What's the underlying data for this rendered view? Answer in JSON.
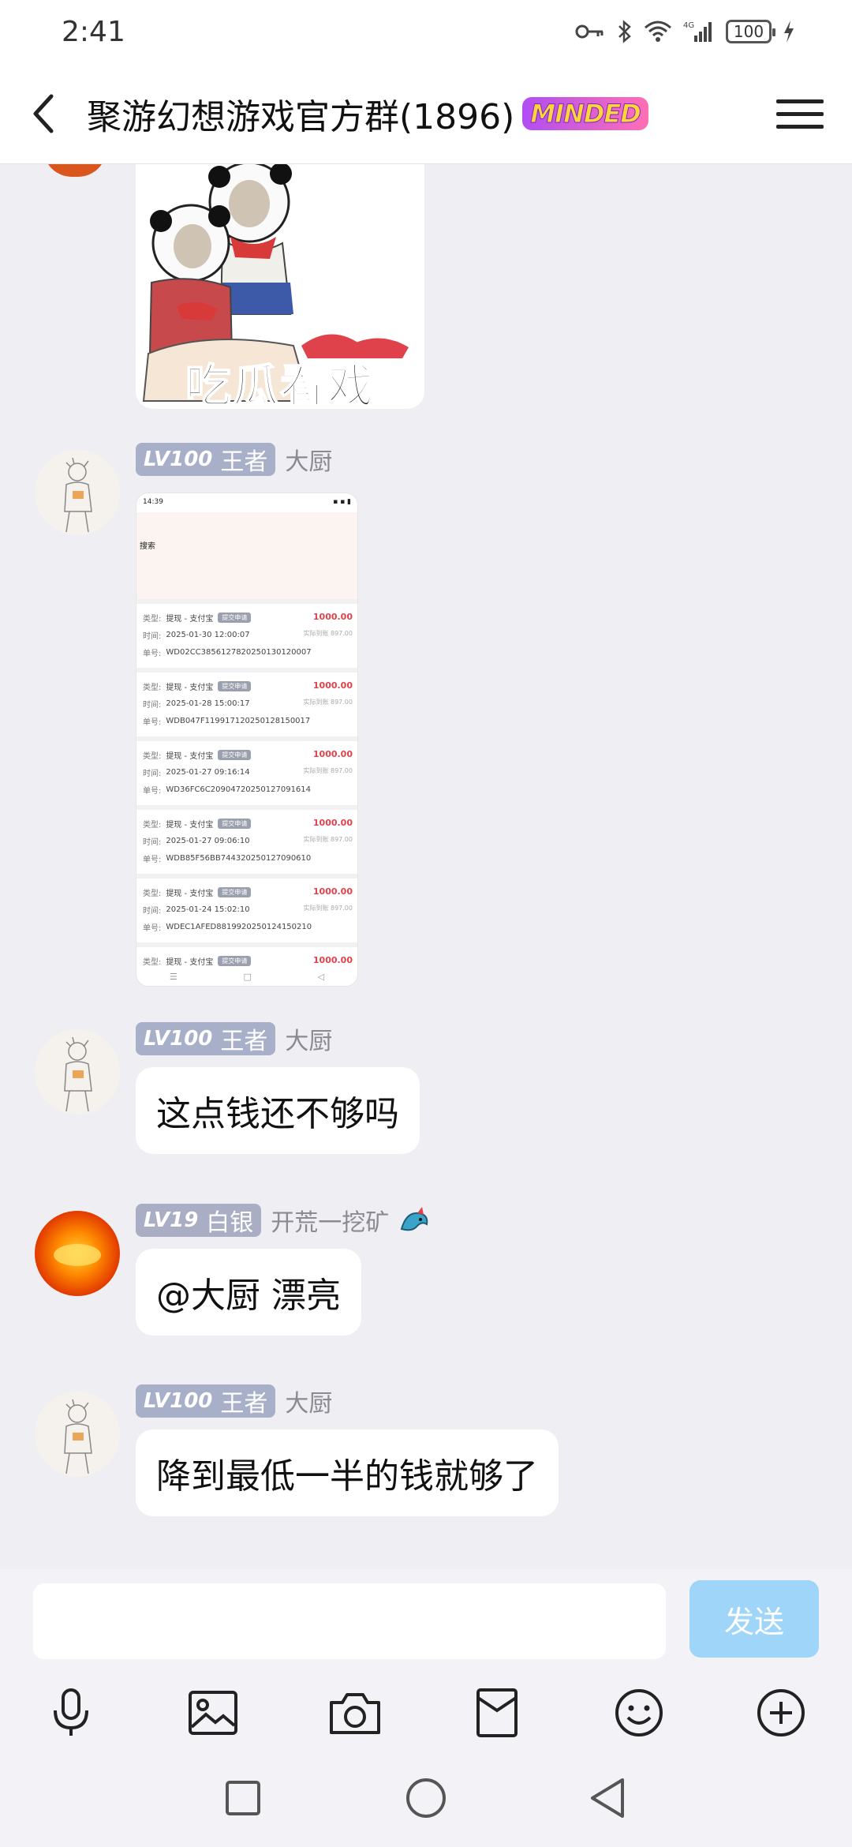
{
  "status": {
    "time": "2:41",
    "battery": "100",
    "network": "4G"
  },
  "header": {
    "title": "聚游幻想游戏官方群(1896)",
    "badge": "MINDED"
  },
  "sticker": {
    "caption": "吃瓜看戏"
  },
  "messages": [
    {
      "level": "LV100",
      "rank": "王者",
      "name": "大厨"
    },
    {
      "level": "LV100",
      "rank": "王者",
      "name": "大厨",
      "text": "这点钱还不够吗"
    },
    {
      "level": "LV19",
      "rank": "白银",
      "name": "开荒一挖矿",
      "text": "@大厨 漂亮"
    },
    {
      "level": "LV100",
      "rank": "王者",
      "name": "大厨",
      "text": "降到最低一半的钱就够了"
    }
  ],
  "screenshot": {
    "time": "14:39",
    "search": "搜索",
    "rows": [
      {
        "type": "提现 - 支付宝",
        "tag": "提交申请",
        "amount": "1000.00",
        "real": "实际到账 897.00",
        "time": "2025-01-30 12:00:07",
        "order": "WD02CC3856127820250130120007"
      },
      {
        "type": "提现 - 支付宝",
        "tag": "提交申请",
        "amount": "1000.00",
        "real": "实际到账 897.00",
        "time": "2025-01-28 15:00:17",
        "order": "WDB047F119917120250128150017"
      },
      {
        "type": "提现 - 支付宝",
        "tag": "提交申请",
        "amount": "1000.00",
        "real": "实际到账 897.00",
        "time": "2025-01-27 09:16:14",
        "order": "WD36FC6C20904720250127091614"
      },
      {
        "type": "提现 - 支付宝",
        "tag": "提交申请",
        "amount": "1000.00",
        "real": "实际到账 897.00",
        "time": "2025-01-27 09:06:10",
        "order": "WDB85F56BB744320250127090610"
      },
      {
        "type": "提现 - 支付宝",
        "tag": "提交申请",
        "amount": "1000.00",
        "real": "实际到账 897.00",
        "time": "2025-01-24 15:02:10",
        "order": "WDEC1AFED8819920250124150210"
      },
      {
        "type": "提现 - 支付宝",
        "tag": "提交申请",
        "amount": "1000.00",
        "real": "",
        "time": "",
        "order": ""
      }
    ],
    "labels": {
      "type": "类型:",
      "time": "时间:",
      "order": "单号:"
    }
  },
  "composer": {
    "send_label": "发送",
    "input_value": ""
  },
  "colors": {
    "send_button": "#9fd5f8",
    "badge": "#a7b0c8",
    "amount": "#e0424b",
    "background": "#eeeef3"
  },
  "icons": [
    "back-icon",
    "menu-icon",
    "microphone-icon",
    "image-icon",
    "camera-icon",
    "red-packet-icon",
    "emoji-icon",
    "plus-icon"
  ]
}
